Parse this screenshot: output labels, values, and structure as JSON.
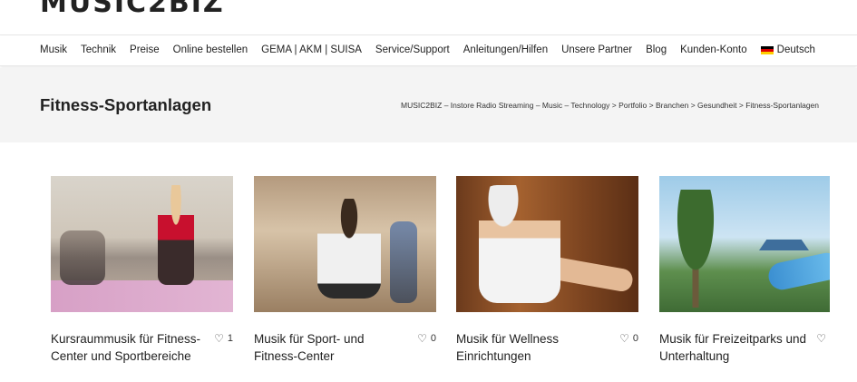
{
  "brand": {
    "logo_text": "MUSIC2BIZ"
  },
  "nav": {
    "items": [
      "Musik",
      "Technik",
      "Preise",
      "Online bestellen",
      "GEMA | AKM | SUISA",
      "Service/Support",
      "Anleitungen/Hilfen",
      "Unsere Partner",
      "Blog",
      "Kunden-Konto"
    ],
    "language": "Deutsch",
    "language_icon": "german-flag-icon"
  },
  "header": {
    "page_title": "Fitness-Sportanlagen",
    "breadcrumb": "MUSIC2BIZ – Instore Radio Streaming – Music – Technology > Portfolio > Branchen > Gesundheit > Fitness-Sportanlagen"
  },
  "portfolio": [
    {
      "title": "Kursraummusik für Fitness-Center und Sportbereiche",
      "likes": "1"
    },
    {
      "title": "Musik für Sport- und Fitness-Center",
      "likes": "0"
    },
    {
      "title": "Musik für Wellness Einrichtungen",
      "likes": "0"
    },
    {
      "title": "Musik für Freizeitparks und Unterhaltung",
      "likes": ""
    }
  ]
}
